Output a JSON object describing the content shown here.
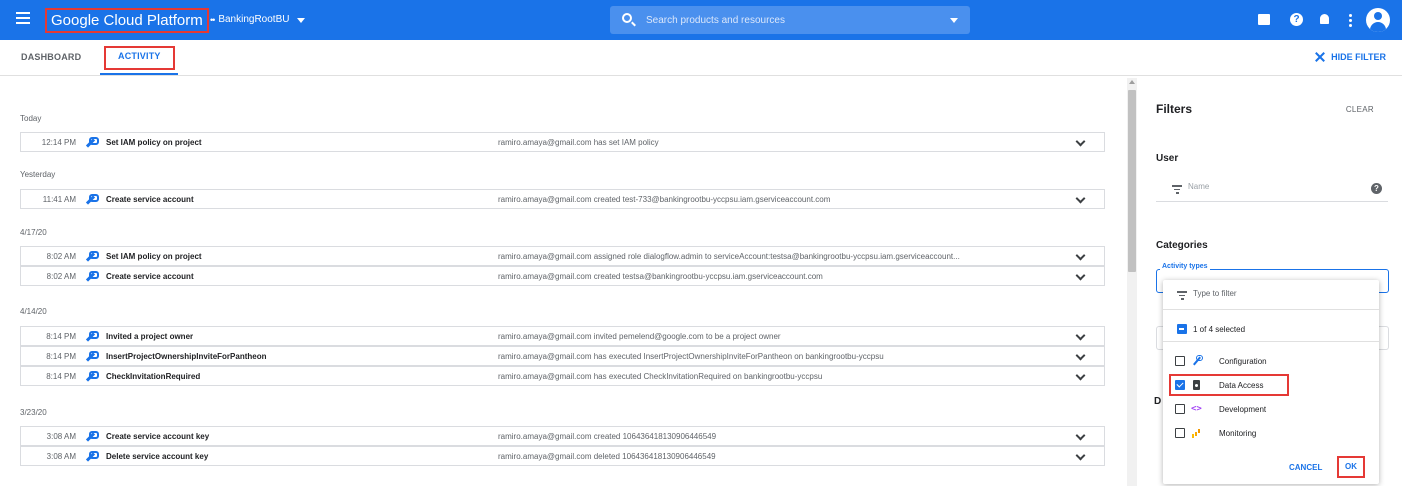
{
  "header": {
    "product_name": "Google Cloud Platform",
    "project_name": "BankingRootBU",
    "search_placeholder": "Search products and resources",
    "brand_color": "#1a73e8"
  },
  "tabs": [
    {
      "label": "DASHBOARD",
      "active": false
    },
    {
      "label": "ACTIVITY",
      "active": true
    }
  ],
  "hide_filter_label": "HIDE FILTER",
  "activity": {
    "groups": [
      {
        "date": "Today",
        "rows": [
          {
            "time": "12:14 PM",
            "title": "Set IAM policy on project",
            "description": "ramiro.amaya@gmail.com has set IAM policy",
            "icon": "wrench-icon"
          }
        ]
      },
      {
        "date": "Yesterday",
        "rows": [
          {
            "time": "11:41 AM",
            "title": "Create service account",
            "description": "ramiro.amaya@gmail.com created test-733@bankingrootbu-yccpsu.iam.gserviceaccount.com",
            "icon": "wrench-icon"
          }
        ]
      },
      {
        "date": "4/17/20",
        "rows": [
          {
            "time": "8:02 AM",
            "title": "Set IAM policy on project",
            "description": "ramiro.amaya@gmail.com assigned role dialogflow.admin to serviceAccount:testsa@bankingrootbu-yccpsu.iam.gserviceaccount...",
            "icon": "wrench-icon"
          },
          {
            "time": "8:02 AM",
            "title": "Create service account",
            "description": "ramiro.amaya@gmail.com created testsa@bankingrootbu-yccpsu.iam.gserviceaccount.com",
            "icon": "wrench-icon"
          }
        ]
      },
      {
        "date": "4/14/20",
        "rows": [
          {
            "time": "8:14 PM",
            "title": "Invited a project owner",
            "description": "ramiro.amaya@gmail.com invited pemelend@google.com to be a project owner",
            "icon": "wrench-icon"
          },
          {
            "time": "8:14 PM",
            "title": "InsertProjectOwnershipInviteForPantheon",
            "description": "ramiro.amaya@gmail.com has executed InsertProjectOwnershipInviteForPantheon on bankingrootbu-yccpsu",
            "icon": "wrench-icon"
          },
          {
            "time": "8:14 PM",
            "title": "CheckInvitationRequired",
            "description": "ramiro.amaya@gmail.com has executed CheckInvitationRequired on bankingrootbu-yccpsu",
            "icon": "wrench-icon"
          }
        ]
      },
      {
        "date": "3/23/20",
        "rows": [
          {
            "time": "3:08 AM",
            "title": "Create service account key",
            "description": "ramiro.amaya@gmail.com created 106436418130906446549",
            "icon": "wrench-icon"
          },
          {
            "time": "3:08 AM",
            "title": "Delete service account key",
            "description": "ramiro.amaya@gmail.com deleted 106436418130906446549",
            "icon": "wrench-icon"
          }
        ]
      }
    ]
  },
  "filters": {
    "title": "Filters",
    "clear_label": "CLEAR",
    "user_label": "User",
    "user_placeholder": "Name",
    "categories_label": "Categories",
    "activity_types_label": "Activity types",
    "hidden_section_initial": "D"
  },
  "dropdown": {
    "filter_placeholder": "Type to filter",
    "selected_summary": "1 of 4 selected",
    "options": [
      {
        "label": "Configuration",
        "checked": false,
        "icon": "wrench-icon"
      },
      {
        "label": "Data Access",
        "checked": true,
        "icon": "data-access-icon"
      },
      {
        "label": "Development",
        "checked": false,
        "icon": "code-icon"
      },
      {
        "label": "Monitoring",
        "checked": false,
        "icon": "bar-chart-icon"
      }
    ],
    "cancel_label": "CANCEL",
    "ok_label": "OK"
  }
}
